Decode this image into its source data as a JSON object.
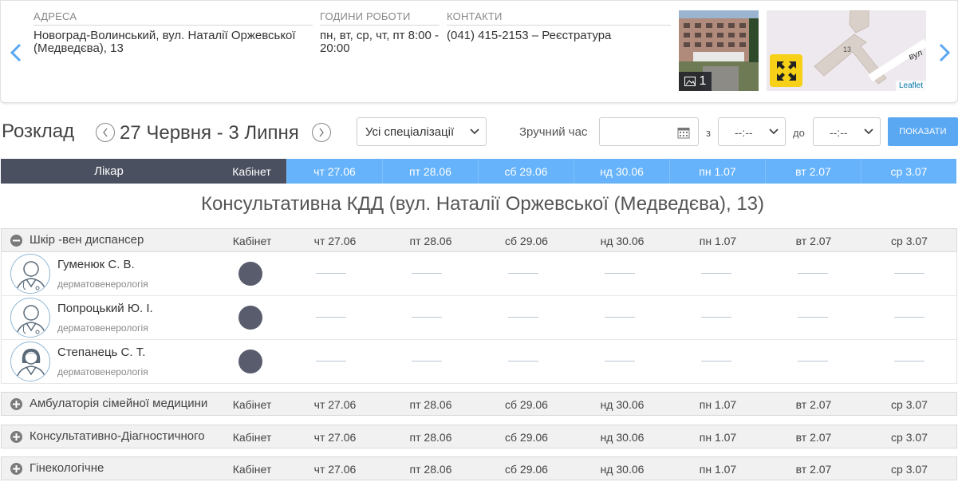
{
  "info": {
    "address_label": "АДРЕСА",
    "address_value": "Новоград-Волинський, вул. Наталії Оржевської (Медведєва), 13",
    "hours_label": "ГОДИНИ РОБОТИ",
    "hours_value": "пн, вт, ср, чт, пт 8:00 - 20:00",
    "contacts_label": "КОНТАКТИ",
    "contacts_value": "(041) 415-2153 – Реєстратура",
    "photo_count": "1",
    "map_street_label": "вул",
    "map_house_label": "13",
    "map_attribution": "Leaflet"
  },
  "schedule": {
    "title": "Розклад",
    "week_range": "27 Червня - 3 Липня",
    "specialization_select": "Усі спеціалізації",
    "convenient_time_label": "Зручний час",
    "from_label": "з",
    "to_label": "до",
    "time_from_value": "--:--",
    "time_to_value": "--:--",
    "show_button": "ПОКАЗАТИ"
  },
  "header": {
    "doctor": "Лікар",
    "cabinet": "Кабінет",
    "days": [
      "чт 27.06",
      "пт 28.06",
      "сб 29.06",
      "нд 30.06",
      "пн 1.07",
      "вт 2.07",
      "ср 3.07"
    ]
  },
  "clinic_title": "Консультативна КДД (вул. Наталії Оржевської (Медведєва), 13)",
  "groups": [
    {
      "name": "Шкір -вен диспансер",
      "expanded": true,
      "cabinet": "Кабінет",
      "doctors": [
        {
          "name": "Гуменюк С. В.",
          "specialty": "дерматовенерологія",
          "avatar": "male-doctor-icon"
        },
        {
          "name": "Попроцький Ю. І.",
          "specialty": "дерматовенерологія",
          "avatar": "male-doctor-icon"
        },
        {
          "name": "Степанець С. Т.",
          "specialty": "дерматовенерологія",
          "avatar": "female-doctor-icon"
        }
      ]
    },
    {
      "name": "Амбулаторія сімейної медицини",
      "expanded": false,
      "cabinet": "Кабінет"
    },
    {
      "name": "Консультативно-Діагностичного",
      "expanded": false,
      "cabinet": "Кабінет"
    },
    {
      "name": "Гінекологічне",
      "expanded": false,
      "cabinet": "Кабінет"
    }
  ],
  "colors": {
    "header_dark": "#4b5060",
    "header_blue": "#66b3fb",
    "show_button": "#5aa8f2",
    "expand_button": "#f7d117",
    "nav_arrow": "#5aa8f2"
  }
}
